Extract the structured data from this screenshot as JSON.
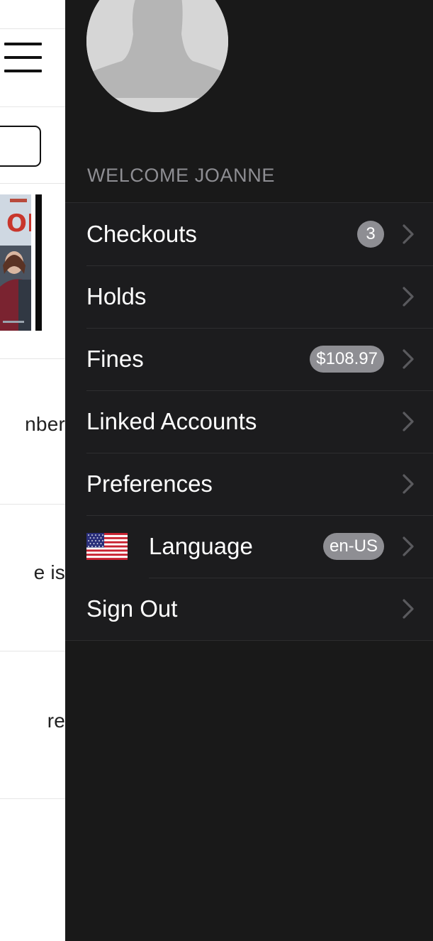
{
  "underlay": {
    "snippets": [
      "nber",
      "e is",
      "re"
    ]
  },
  "drawer": {
    "welcome": "WELCOME JOANNE",
    "menu": [
      {
        "label": "Checkouts",
        "badge": "3"
      },
      {
        "label": "Holds"
      },
      {
        "label": "Fines",
        "badge": "$108.97"
      },
      {
        "label": "Linked Accounts"
      },
      {
        "label": "Preferences"
      },
      {
        "label": "Language",
        "badge": "en-US",
        "icon": "us-flag-icon"
      },
      {
        "label": "Sign Out"
      }
    ]
  },
  "colors": {
    "drawer_bg": "#191919",
    "menu_bg": "#1c1c1e",
    "badge": "#8e8e93",
    "muted_text": "#8e8e93",
    "chevron": "#5a5a5e"
  },
  "icons": {
    "hamburger": "hamburger-menu-icon",
    "avatar": "default-avatar-icon",
    "chevron": "chevron-right-icon",
    "flag": "us-flag-icon"
  }
}
